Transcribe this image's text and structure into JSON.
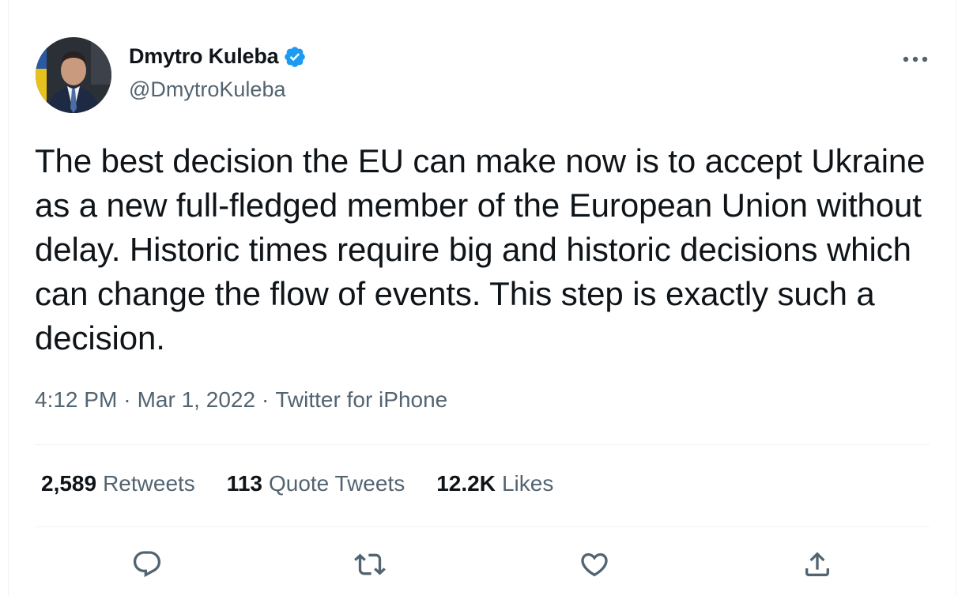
{
  "author": {
    "display_name": "Dmytro Kuleba",
    "handle": "@DmytroKuleba",
    "verified": true
  },
  "tweet": {
    "text": "The best decision the EU can make now is to accept Ukraine as a new full-fledged member of the European Union without delay. Historic times require big and historic decisions which can change the flow of events. This step is exactly such a decision.",
    "time": "4:12 PM",
    "date": "Mar 1, 2022",
    "source": "Twitter for iPhone"
  },
  "stats": {
    "retweets_count": "2,589",
    "retweets_label": "Retweets",
    "quotes_count": "113",
    "quotes_label": "Quote Tweets",
    "likes_count": "12.2K",
    "likes_label": "Likes"
  },
  "meta_separator": "·",
  "colors": {
    "text": "#0f1419",
    "secondary": "#536471",
    "verified_blue": "#1d9bf0",
    "divider": "#eff3f4"
  },
  "icons": {
    "reply": "speech-bubble-icon",
    "retweet": "retweet-icon",
    "like": "heart-icon",
    "share": "share-icon",
    "more": "more-dots-icon",
    "verified": "verified-badge-icon"
  }
}
